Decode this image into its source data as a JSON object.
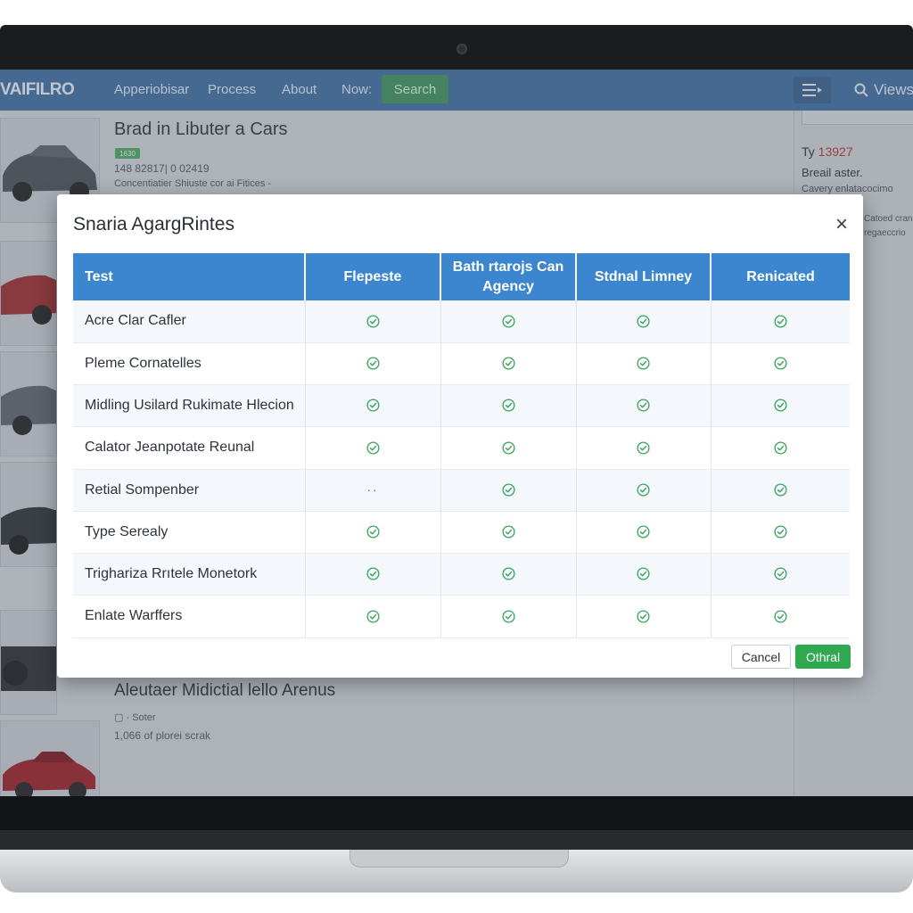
{
  "navbar": {
    "logo": "VAIFILRO",
    "links": [
      "Apperiobisar",
      "Process",
      "About",
      "Now:"
    ],
    "search_label": "Search",
    "view_label": "Views"
  },
  "listings": [
    {
      "title": "Brad in Libuter a Cars",
      "tag": "1630",
      "meta1": "148 82817| 0 02419",
      "meta2": "Concentiatier Shiuste cor ai Fitices -"
    },
    {
      "title": "Aleutaer Midictial lello Arenus",
      "meta1": "Soter",
      "meta2": "1,066 of plorei scrak"
    }
  ],
  "sidebar": {
    "price_prefix": "Ty",
    "price_value": "13927",
    "subtitle": "Breail aster.",
    "line1": "Cavery enlatacocimo",
    "line2": "Catoed cran",
    "line3": "regaeccrio"
  },
  "modal": {
    "title": "Snaria AgargRintes",
    "close": "×",
    "columns": [
      "Test",
      "Flepeste",
      "Bath rtarojs Can Agency",
      "Stdnal Limney",
      "Renicated"
    ],
    "rows": [
      {
        "label": "Acre Clar Cafler",
        "cells": [
          "check",
          "check",
          "check",
          "check"
        ]
      },
      {
        "label": "Pleme Cornatelles",
        "cells": [
          "check",
          "check",
          "check",
          "check"
        ]
      },
      {
        "label": "Midling Usilard Rukimate Hlecion",
        "cells": [
          "check",
          "check",
          "check",
          "check"
        ]
      },
      {
        "label": "Calator Jeanpotate Reunal",
        "cells": [
          "check",
          "check",
          "check",
          "check"
        ]
      },
      {
        "label": "Retial Sompenber",
        "cells": [
          "dash",
          "check",
          "check",
          "check"
        ]
      },
      {
        "label": "Type Serealy",
        "cells": [
          "check",
          "check",
          "check",
          "check"
        ]
      },
      {
        "label": "Trigharizа Rrıtele Monetork",
        "cells": [
          "check",
          "check",
          "check",
          "check"
        ]
      },
      {
        "label": "Enlate Warffers",
        "cells": [
          "check",
          "check",
          "check",
          "check"
        ]
      }
    ],
    "cancel_label": "Cancel",
    "ok_label": "Othral"
  },
  "colors": {
    "nav_bg": "#3d6c9e",
    "table_header": "#3b86cf",
    "check_green": "#3aa35a",
    "ok_button": "#2fa84f"
  }
}
